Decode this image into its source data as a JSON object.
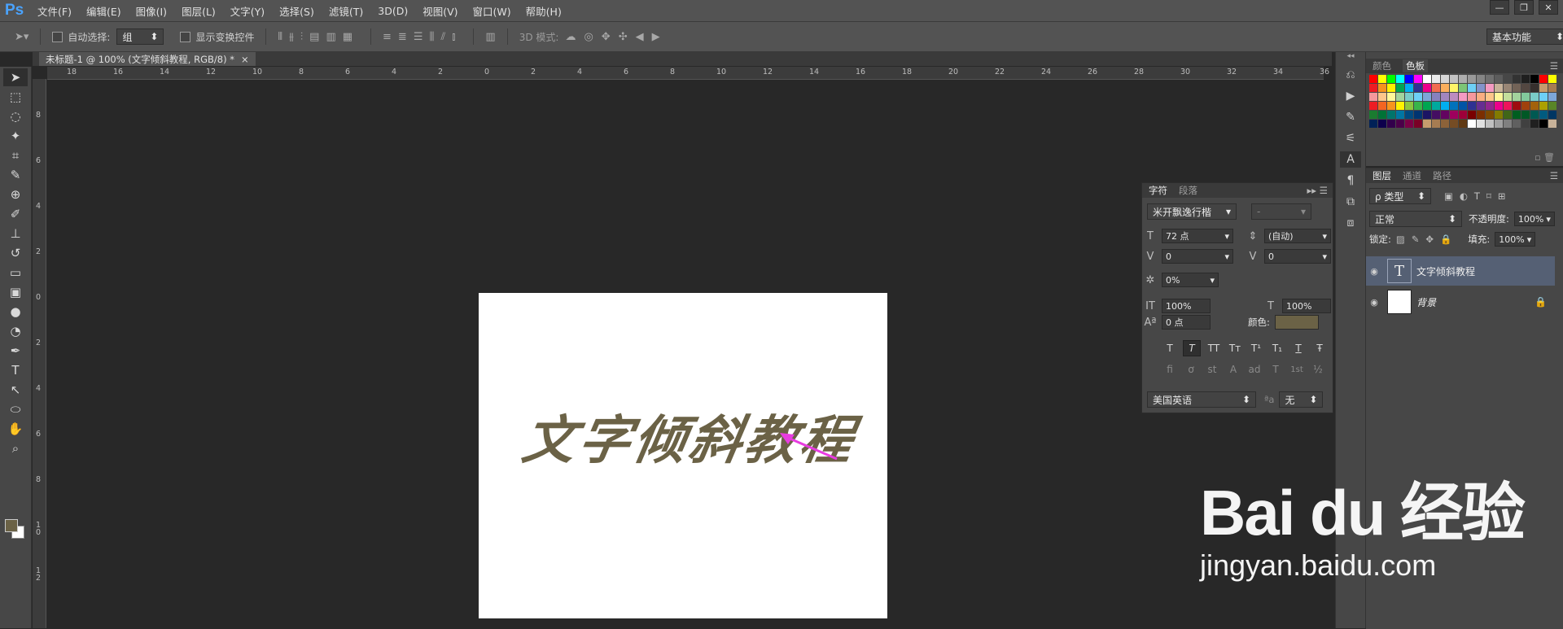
{
  "app": {
    "logo": "Ps"
  },
  "menu": [
    "文件(F)",
    "编辑(E)",
    "图像(I)",
    "图层(L)",
    "文字(Y)",
    "选择(S)",
    "滤镜(T)",
    "3D(D)",
    "视图(V)",
    "窗口(W)",
    "帮助(H)"
  ],
  "window_controls": [
    "—",
    "❐",
    "✕"
  ],
  "options": {
    "auto_select_label": "自动选择:",
    "auto_select_value": "组",
    "show_transform_label": "显示变换控件",
    "mode_3d_label": "3D 模式:",
    "workspace": "基本功能"
  },
  "document": {
    "tab_title": "未标题-1 @ 100% (文字倾斜教程, RGB/8) *",
    "canvas_text": "文字倾斜教程",
    "text_color": "#6b6246"
  },
  "rulers": {
    "h_labels": [
      "18",
      "16",
      "14",
      "12",
      "10",
      "8",
      "6",
      "4",
      "2",
      "0",
      "2",
      "4",
      "6",
      "8",
      "10",
      "12",
      "14",
      "16",
      "18",
      "20",
      "22",
      "24",
      "26",
      "28",
      "30",
      "32",
      "34",
      "36"
    ],
    "v_labels": [
      "8",
      "6",
      "4",
      "2",
      "0",
      "2",
      "4",
      "6",
      "8",
      "1\n0",
      "1\n2"
    ]
  },
  "toolbar": {
    "tools": [
      "move-tool",
      "marquee-tool",
      "lasso-tool",
      "magic-wand-tool",
      "crop-tool",
      "eyedropper-tool",
      "healing-tool",
      "brush-tool",
      "stamp-tool",
      "history-brush-tool",
      "eraser-tool",
      "gradient-tool",
      "blur-tool",
      "dodge-tool",
      "pen-tool",
      "type-tool",
      "path-select-tool",
      "shape-tool",
      "hand-tool",
      "zoom-tool"
    ],
    "glyphs": [
      "➤",
      "⬚",
      "◌",
      "✦",
      "⌗",
      "✎",
      "⊕",
      "✐",
      "⊥",
      "↺",
      "▭",
      "▣",
      "●",
      "◔",
      "✒",
      "T",
      "↖",
      "⬭",
      "✋",
      "⌕"
    ],
    "foreground_color": "#6b6246",
    "background_color": "#ffffff"
  },
  "char_panel": {
    "tabs": [
      "字符",
      "段落"
    ],
    "font_family": "米开飘逸行楷",
    "font_style": "-",
    "size": "72 点",
    "leading": "(自动)",
    "kerning": "0",
    "tracking": "0",
    "tsume": "0%",
    "vertical_scale": "100%",
    "horizontal_scale": "100%",
    "baseline": "0 点",
    "color_label": "颜色:",
    "color": "#6b6246",
    "format_buttons": [
      "T",
      "T",
      "TT",
      "Tт",
      "T¹",
      "T₁",
      "T",
      "Ŧ"
    ],
    "opentype_buttons": [
      "fi",
      "ơ",
      "st",
      "A",
      "ad",
      "T",
      "1st",
      "½"
    ],
    "language": "美国英语",
    "aa_label": "ªa",
    "antialias": "无"
  },
  "swatches": {
    "tabs": [
      "颜色",
      "色板"
    ],
    "colors": [
      "#ff0000",
      "#ffff00",
      "#00ff00",
      "#00ffff",
      "#0000ff",
      "#ff00ff",
      "#ffffff",
      "#ebebeb",
      "#d6d6d6",
      "#c2c2c2",
      "#adadad",
      "#999999",
      "#858585",
      "#707070",
      "#5c5c5c",
      "#474747",
      "#333333",
      "#1f1f1f",
      "#000000",
      "#ff0000",
      "#ffff00",
      "#ed1c24",
      "#f7941d",
      "#fff200",
      "#00a651",
      "#00aeef",
      "#2e3192",
      "#ec008c",
      "#f26c4f",
      "#fbaf5d",
      "#fff568",
      "#7cc576",
      "#6dcff6",
      "#8393ca",
      "#f49ac1",
      "#c7b299",
      "#998675",
      "#736357",
      "#534741",
      "#362f2d",
      "#c69c6d",
      "#a67c52",
      "#f5989d",
      "#fdc68a",
      "#fff799",
      "#a3d39c",
      "#7accc8",
      "#6dcff6",
      "#7da7d9",
      "#8781bd",
      "#a186be",
      "#bd8cbf",
      "#f49ac2",
      "#f6989d",
      "#f9ad81",
      "#fdc68a",
      "#fff79a",
      "#c4df9b",
      "#a3d39c",
      "#82ca9c",
      "#7accc8",
      "#6dcff6",
      "#7da7d9",
      "#ed1c24",
      "#f26522",
      "#f7941d",
      "#fff200",
      "#8dc63f",
      "#39b54a",
      "#00a651",
      "#00a99d",
      "#00aeef",
      "#0072bc",
      "#0054a6",
      "#2e3192",
      "#662d91",
      "#92278f",
      "#ec008c",
      "#ed145b",
      "#9e0b0f",
      "#a0410d",
      "#a3620a",
      "#aba000",
      "#598527",
      "#1a7b30",
      "#007236",
      "#00746b",
      "#0076a3",
      "#004a80",
      "#003471",
      "#1b1464",
      "#440e62",
      "#630460",
      "#9e005d",
      "#9e0039",
      "#790000",
      "#7b2e00",
      "#7d4900",
      "#827b00",
      "#406618",
      "#005e20",
      "#005826",
      "#005952",
      "#005b7f",
      "#003663",
      "#002157",
      "#0d004c",
      "#32004b",
      "#4b0049",
      "#7b0046",
      "#7a0026",
      "#c69c6d",
      "#a67c52",
      "#8c6239",
      "#754c24",
      "#603913",
      "#ffffff",
      "#e0e0e0",
      "#c0c0c0",
      "#a0a0a0",
      "#808080",
      "#606060",
      "#404040",
      "#202020",
      "#000000",
      "#c7b299"
    ]
  },
  "layers": {
    "tabs": [
      "图层",
      "通道",
      "路径"
    ],
    "filter_label": "ρ 类型",
    "blend_mode": "正常",
    "opacity_label": "不透明度:",
    "opacity": "100%",
    "lock_label": "锁定:",
    "fill_label": "填充:",
    "fill": "100%",
    "items": [
      {
        "name": "文字倾斜教程",
        "thumb": "T",
        "selected": true
      },
      {
        "name": "背景",
        "thumb": "",
        "selected": false
      }
    ]
  },
  "watermark": {
    "logo": "Bai du 经验",
    "url": "jingyan.baidu.com"
  }
}
